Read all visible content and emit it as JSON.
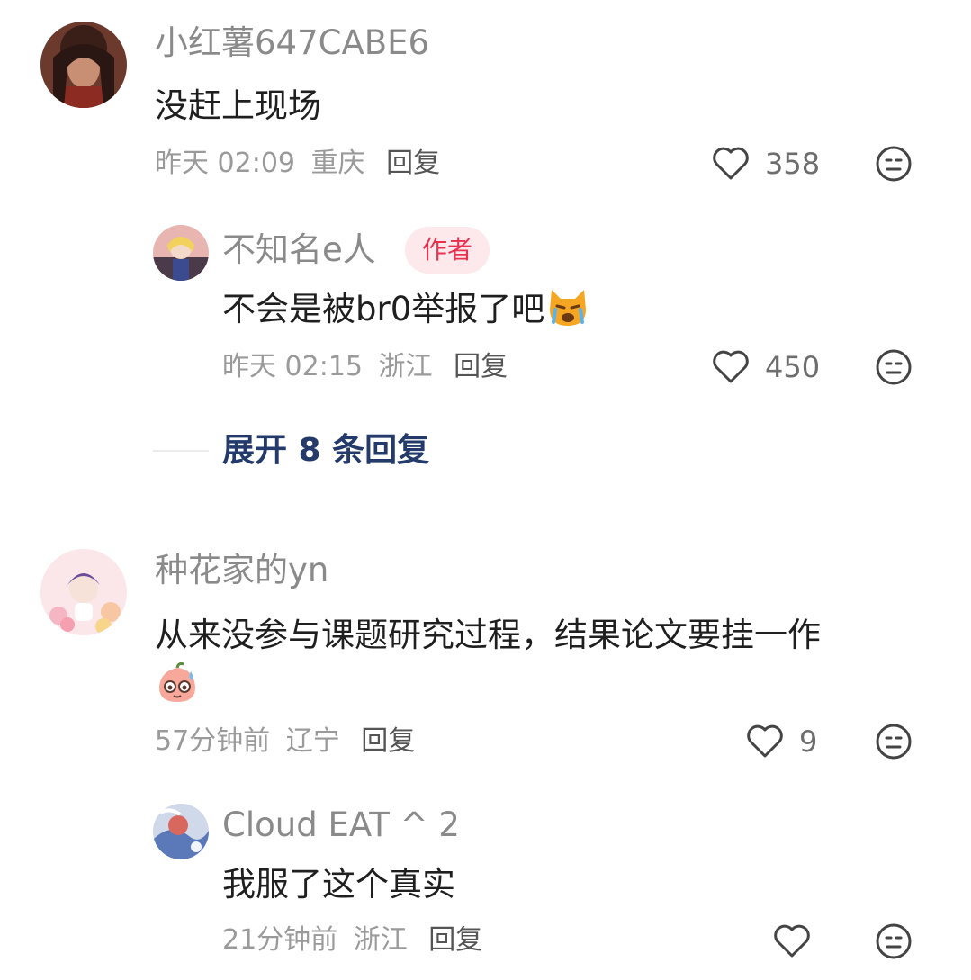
{
  "comments": [
    {
      "username": "小红薯647CABE6",
      "text": "没赶上现场",
      "time": "昨天 02:09",
      "location": "重庆",
      "reply_label": "回复",
      "likes": "358",
      "replies": [
        {
          "username": "不知名e人",
          "badge": "作者",
          "text": "不会是被br0举报了吧",
          "emoji": "crying-cat-emoji",
          "time": "昨天 02:15",
          "location": "浙江",
          "reply_label": "回复",
          "likes": "450"
        }
      ],
      "expand_label": "展开 8 条回复"
    },
    {
      "username": "种花家的yn",
      "text": "从来没参与课题研究过程，结果论文要挂一作",
      "emoji": "sweating-peach-emoji",
      "time": "57分钟前",
      "location": "辽宁",
      "reply_label": "回复",
      "likes": "9",
      "replies": [
        {
          "username": "Cloud EAT ^ 2",
          "text": "我服了这个真实",
          "time": "21分钟前",
          "location": "浙江",
          "reply_label": "回复",
          "likes": ""
        }
      ]
    }
  ],
  "colors": {
    "badge_bg": "#fde8ec",
    "badge_text": "#e8334f",
    "expand_text": "#233a6b"
  }
}
